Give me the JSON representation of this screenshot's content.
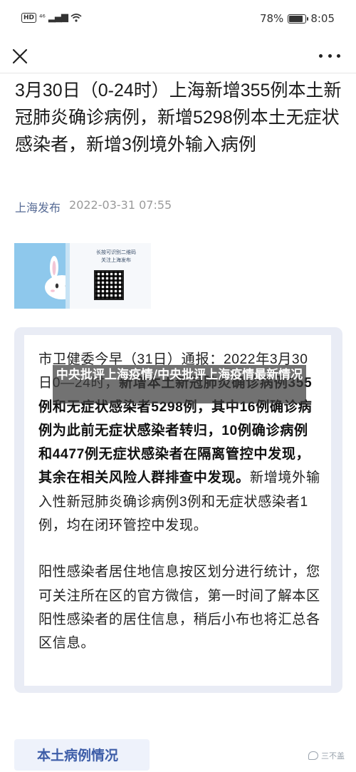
{
  "status_bar": {
    "hd": "HD",
    "network": "⁴⁶",
    "battery": "78%",
    "battery_level": 0.78,
    "time": "8:05"
  },
  "nav": {
    "close_icon": "close-icon",
    "more_icon": "more-icon"
  },
  "article": {
    "title": "3月30日（0-24时）上海新增355例本土新冠肺炎确诊病例，新增5298例本土无症状感染者，新增3例境外输入病例",
    "author": "上海发布",
    "date": "2022-03-31 07:55"
  },
  "banner": {
    "text_line1": "长按可识别二维码",
    "text_line2": "关注上海发布"
  },
  "notice": {
    "p1_normal_prefix": "市卫健委今早（31日）通报：2022年3月30日0—24时，",
    "p1_bold": "新增本土新冠肺炎确诊病例355例和无症状感染者5298例，其中16例确诊病例为此前无症状感染者转归，10例确诊病例和4477例无症状感染者在隔离管控中发现，其余在相关风险人群排查中发现。",
    "p1_normal_suffix": "新增境外输入性新冠肺炎确诊病例3例和无症状感染者1例，均在闭环管控中发现。",
    "p2": "阳性感染者居住地信息按区划分进行统计，您可关注所在区的官方微信，第一时间了解本区阳性感染者的居住信息，稍后小布也将汇总各区信息。"
  },
  "overlay": {
    "caption": "中央批评上海疫情/中央批评上海疫情最新情况"
  },
  "section": {
    "label": "本土病例情况"
  },
  "watermark": {
    "text": "三不盖"
  }
}
